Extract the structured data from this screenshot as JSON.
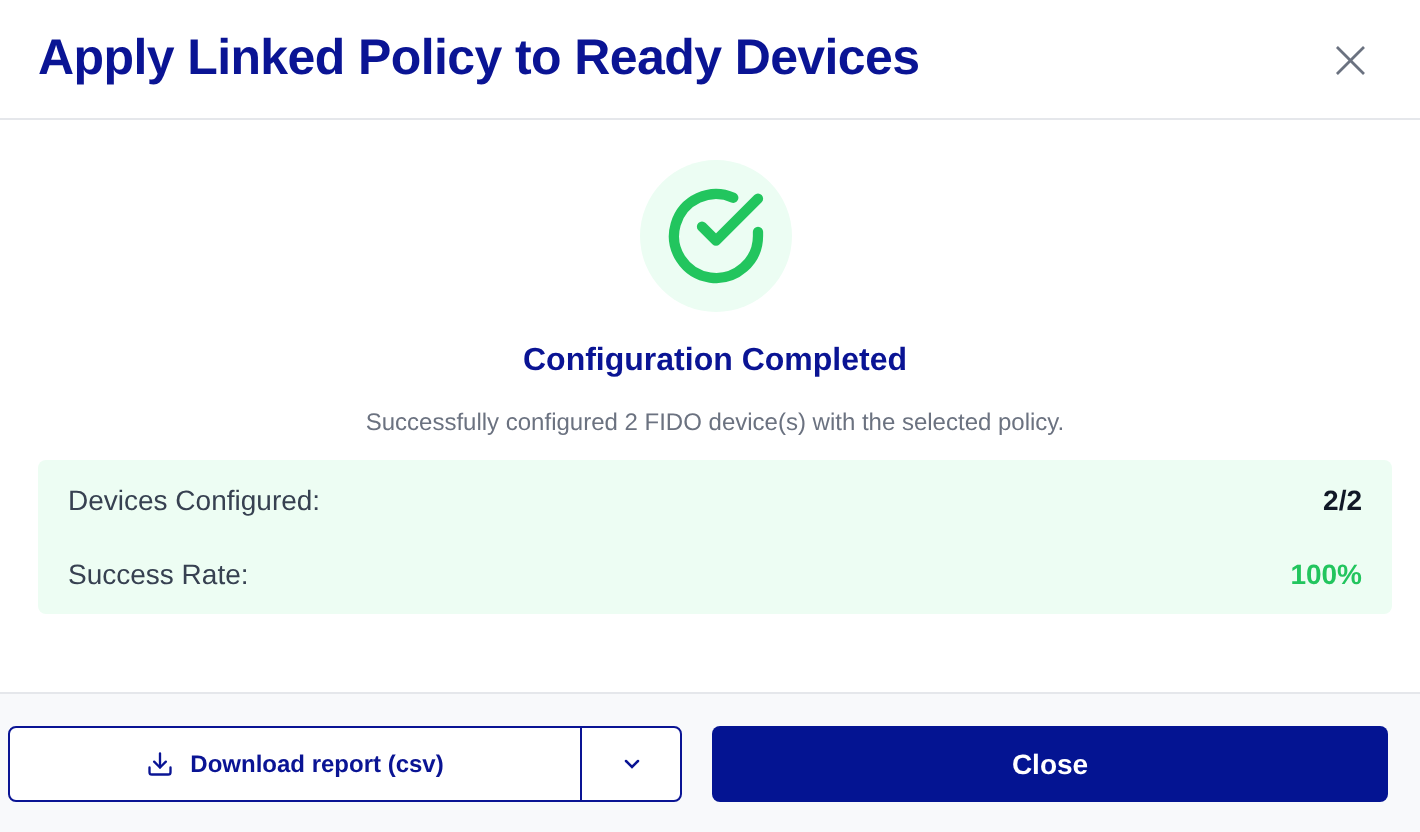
{
  "dialog": {
    "title": "Apply Linked Policy to Ready Devices",
    "close_label": "×"
  },
  "result": {
    "heading": "Configuration Completed",
    "message": "Successfully configured 2 FIDO device(s) with the selected policy."
  },
  "stats": [
    {
      "label": "Devices Configured:",
      "value": "2/2",
      "color": "#111827"
    },
    {
      "label": "Success Rate:",
      "value": "100%",
      "color": "#22c55e"
    }
  ],
  "footer": {
    "download_label": "Download report (csv)",
    "close_button": "Close"
  }
}
